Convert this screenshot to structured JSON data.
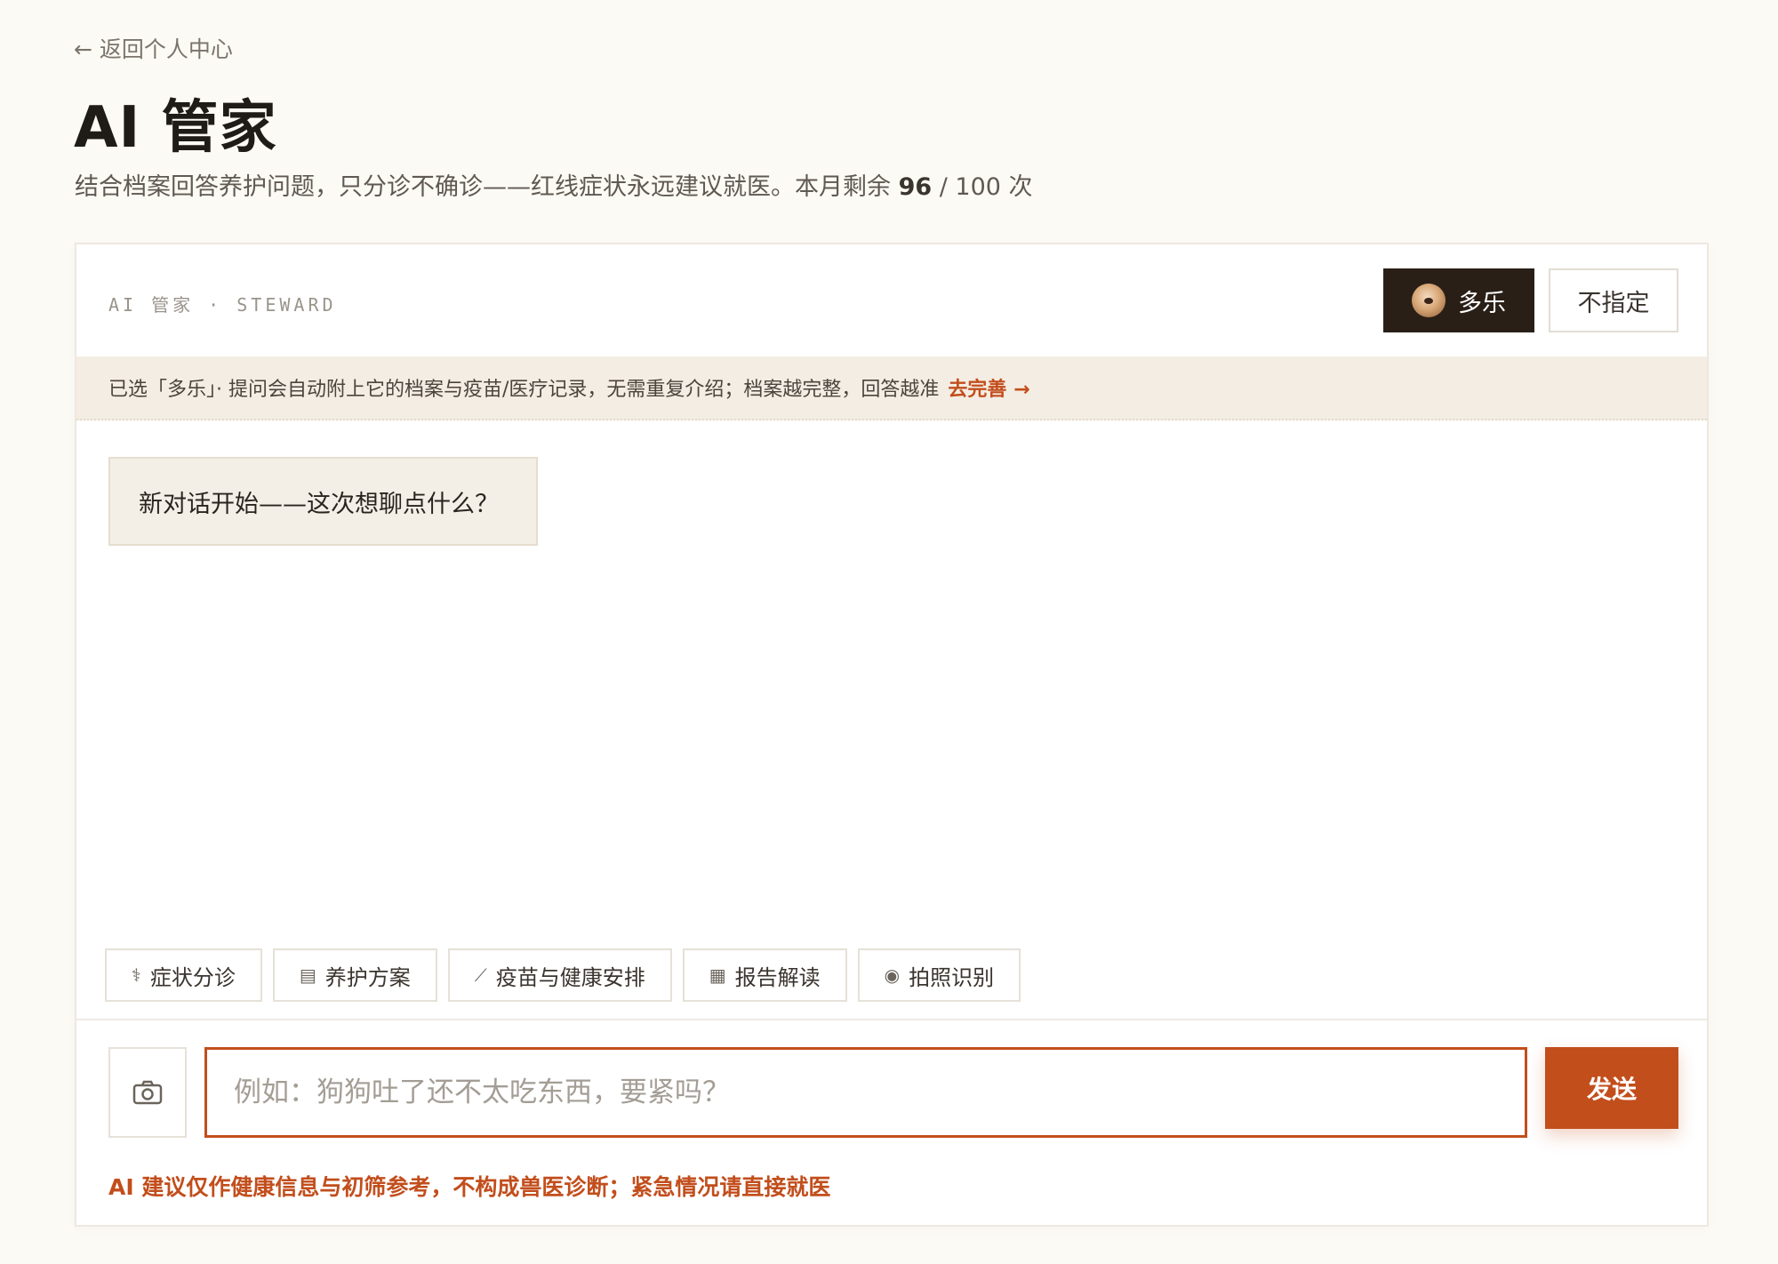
{
  "nav": {
    "back_label": "← 返回个人中心"
  },
  "header": {
    "title": "AI 管家",
    "subtitle_prefix": "结合档案回答养护问题，只分诊不确诊——红线症状永远建议就医。本月剩余 ",
    "remaining": "96",
    "subtitle_suffix": " / 100 次"
  },
  "card": {
    "label": "AI 管家 · STEWARD",
    "pet_selector": {
      "selected_pet": "多乐",
      "none_label": "不指定"
    },
    "notice": {
      "text": "已选「多乐」· 提问会自动附上它的档案与疫苗/医疗记录，无需重复介绍；档案越完整，回答越准",
      "link": "去完善 →"
    },
    "greeting": "新对话开始——这次想聊点什么？",
    "quick_actions": [
      {
        "icon": "stethoscope-icon",
        "glyph": "⚕",
        "label": "症状分诊"
      },
      {
        "icon": "clipboard-icon",
        "glyph": "▤",
        "label": "养护方案"
      },
      {
        "icon": "syringe-icon",
        "glyph": "⟋",
        "label": "疫苗与健康安排"
      },
      {
        "icon": "report-icon",
        "glyph": "▦",
        "label": "报告解读"
      },
      {
        "icon": "camera-icon",
        "glyph": "◉",
        "label": "拍照识别"
      }
    ],
    "input": {
      "placeholder": "例如：狗狗吐了还不太吃东西，要紧吗？",
      "value": ""
    },
    "send_label": "发送",
    "disclaimer": "AI 建议仅作健康信息与初筛参考，不构成兽医诊断；紧急情况请直接就医"
  },
  "colors": {
    "accent": "#c24e1c",
    "dark": "#2a1f17",
    "background": "#fcfaf4"
  }
}
